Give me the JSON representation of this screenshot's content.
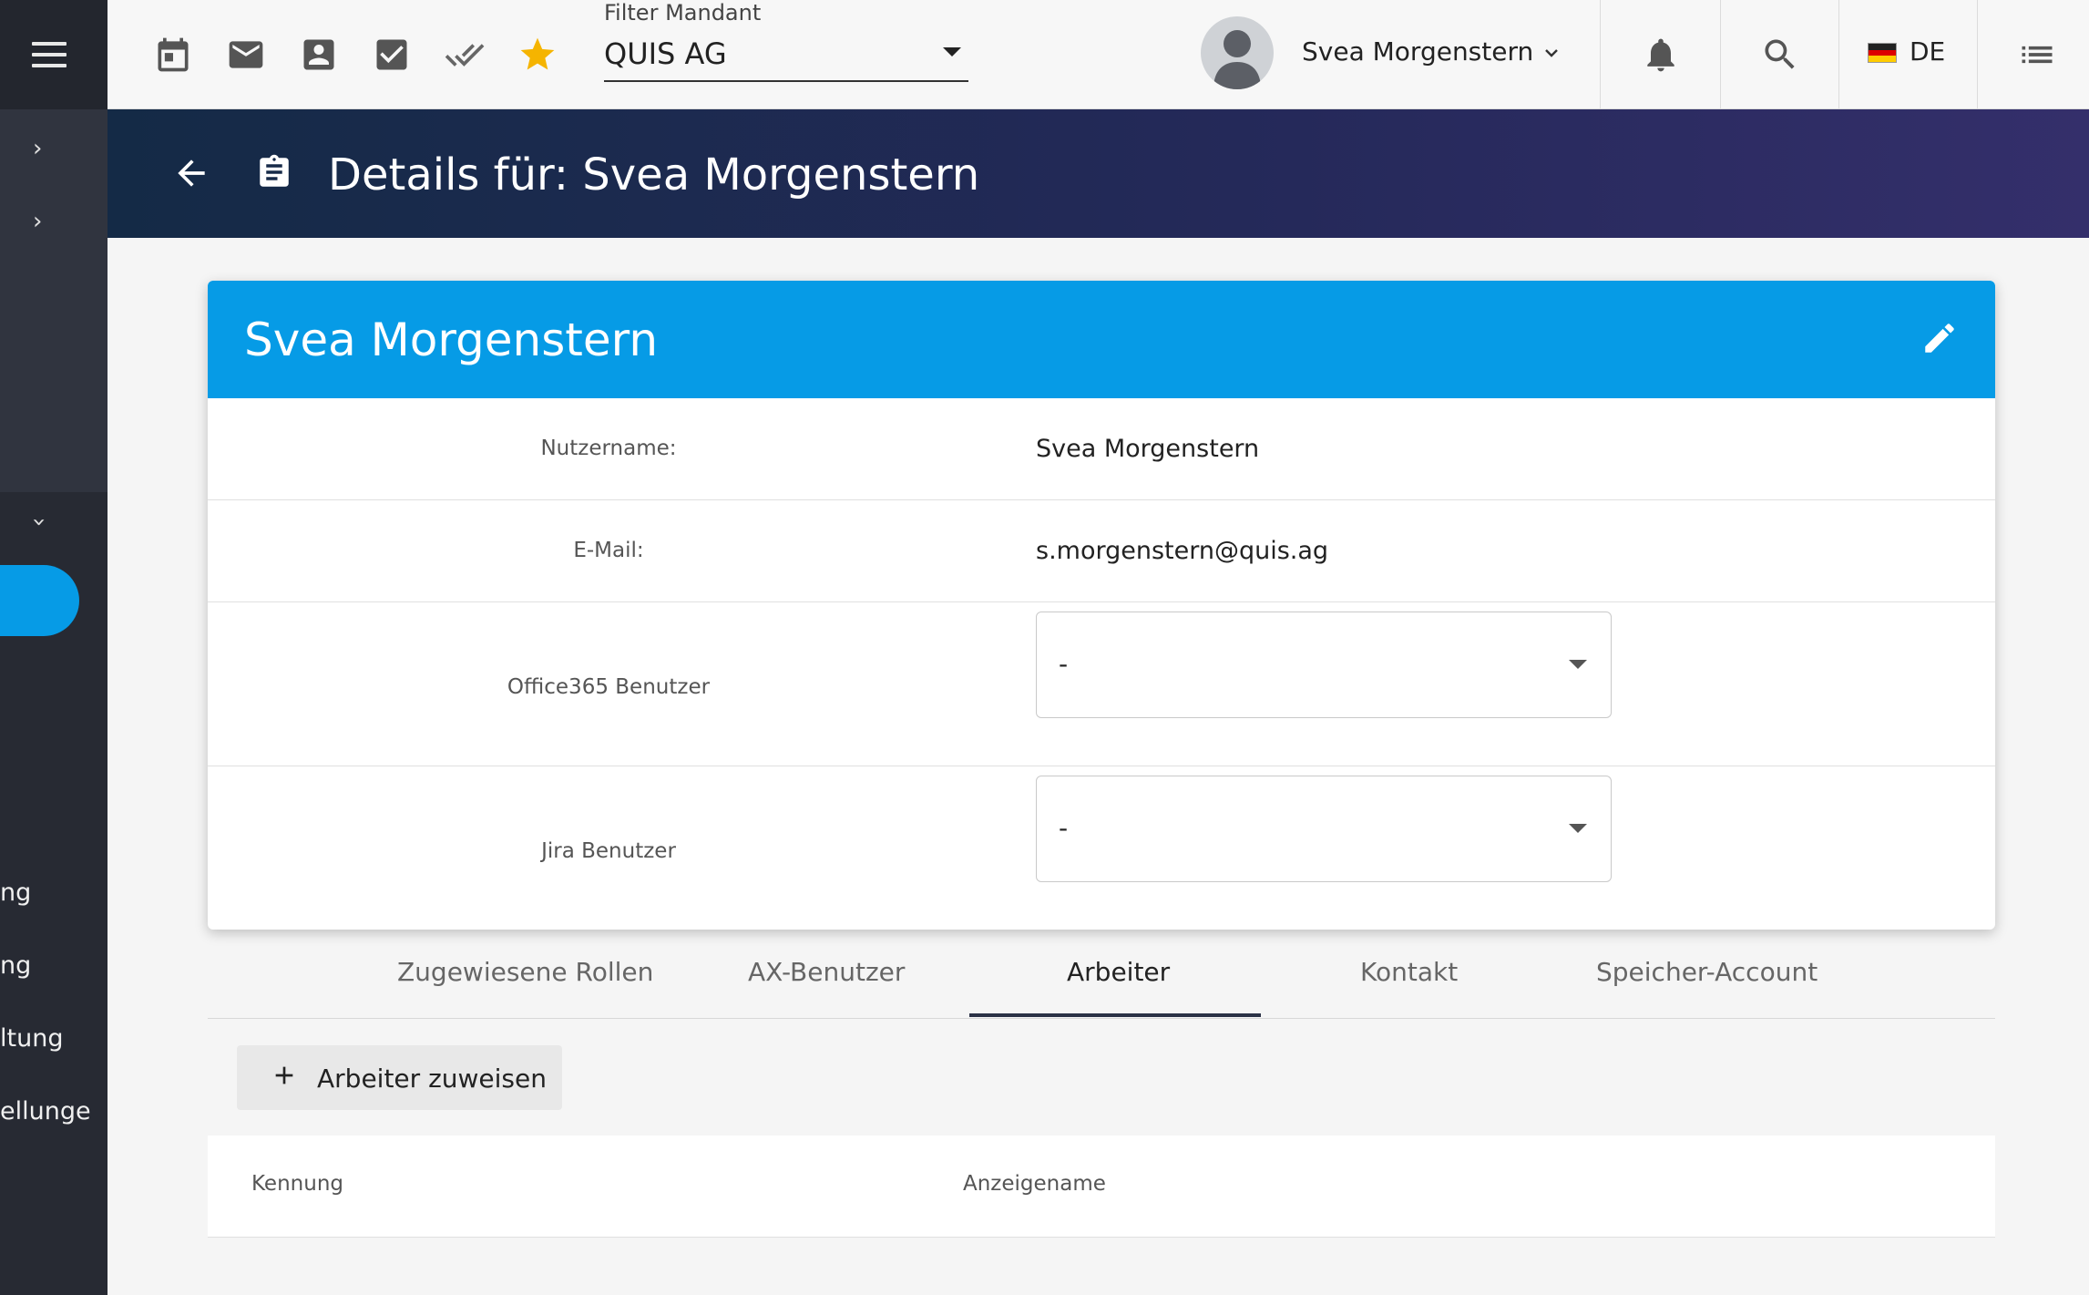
{
  "sidebar": {
    "partial_items": [
      "ng",
      "ng",
      "ltung",
      "ellunge"
    ]
  },
  "topbar": {
    "filter_label": "Filter Mandant",
    "filter_value": "QUIS AG",
    "user_name": "Svea Morgenstern",
    "language": "DE",
    "icons": [
      "calendar-icon",
      "mail-icon",
      "contact-icon",
      "checkbox-icon",
      "done-all-icon",
      "star-icon",
      "bell-icon",
      "search-icon",
      "list-icon"
    ],
    "star_color": "#f5b400"
  },
  "banner": {
    "title": "Details für: Svea Morgenstern"
  },
  "card": {
    "title": "Svea Morgenstern",
    "header_color": "#069be6",
    "fields": [
      {
        "label": "Nutzername:",
        "value": "Svea Morgenstern"
      },
      {
        "label": "E-Mail:",
        "value": "s.morgenstern@quis.ag"
      }
    ],
    "dropdowns": [
      {
        "label": "Office365 Benutzer",
        "value": "-"
      },
      {
        "label": "Jira Benutzer",
        "value": "-"
      }
    ]
  },
  "tabs": {
    "items": [
      "Zugewiesene Rollen",
      "AX-Benutzer",
      "Arbeiter",
      "Kontakt",
      "Speicher-Account"
    ],
    "active": "Arbeiter"
  },
  "actions": {
    "assign_label": "Arbeiter zuweisen"
  },
  "table": {
    "columns": [
      "Kennung",
      "Anzeigename"
    ]
  }
}
